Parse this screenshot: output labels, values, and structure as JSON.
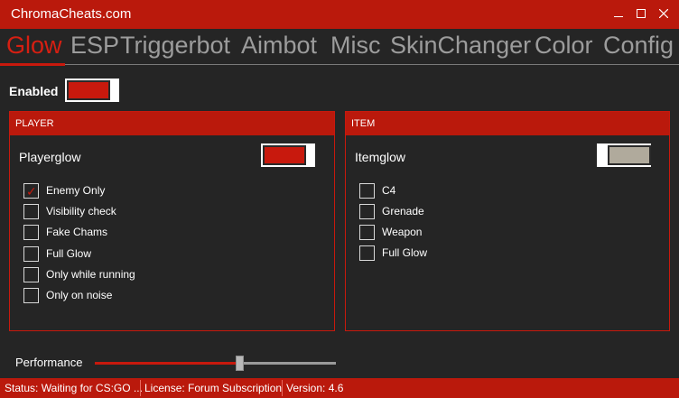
{
  "window": {
    "title": "ChromaCheats.com",
    "minimize_icon": "minimize-icon",
    "maximize_icon": "maximize-icon",
    "close_icon": "close-icon"
  },
  "tabs": [
    {
      "label": "Glow",
      "active": true
    },
    {
      "label": "ESP",
      "active": false
    },
    {
      "label": "Triggerbot",
      "active": false
    },
    {
      "label": "Aimbot",
      "active": false
    },
    {
      "label": "Misc",
      "active": false
    },
    {
      "label": "SkinChanger",
      "active": false
    },
    {
      "label": "Color",
      "active": false
    },
    {
      "label": "Config",
      "active": false
    }
  ],
  "enabled": {
    "label": "Enabled",
    "on": true
  },
  "player": {
    "header": "PLAYER",
    "toggle_label": "Playerglow",
    "toggle_on": true,
    "options": [
      {
        "label": "Enemy Only",
        "checked": true
      },
      {
        "label": "Visibility check",
        "checked": false
      },
      {
        "label": "Fake Chams",
        "checked": false
      },
      {
        "label": "Full Glow",
        "checked": false
      },
      {
        "label": "Only while running",
        "checked": false
      },
      {
        "label": "Only on noise",
        "checked": false
      }
    ]
  },
  "item": {
    "header": "ITEM",
    "toggle_label": "Itemglow",
    "toggle_on": false,
    "options": [
      {
        "label": "C4",
        "checked": false
      },
      {
        "label": "Grenade",
        "checked": false
      },
      {
        "label": "Weapon",
        "checked": false
      },
      {
        "label": "Full Glow",
        "checked": false
      }
    ]
  },
  "performance": {
    "label": "Performance",
    "value": 0.6
  },
  "status": {
    "status_text": "Status: Waiting for CS:GO ...",
    "license_text": "License: Forum Subscription",
    "version_text": "Version: 4.6"
  },
  "colors": {
    "accent": "#ba190c",
    "background": "#252525",
    "tab_inactive": "#9c9c9c",
    "tab_active": "#d61f12"
  }
}
